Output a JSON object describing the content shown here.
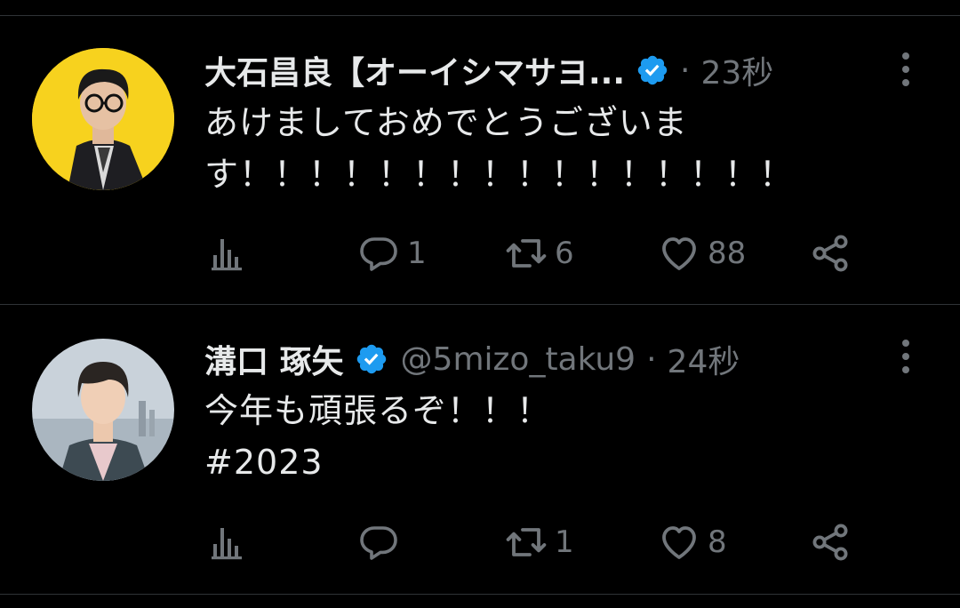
{
  "colors": {
    "background": "#000000",
    "text": "#e7e9ea",
    "muted": "#71767b",
    "divider": "#2f3336",
    "verified": "#1d9bf0"
  },
  "tweets": [
    {
      "name": "大石昌良【オーイシマサヨ...",
      "verified": true,
      "handle": "",
      "separator": "·",
      "time": "23秒",
      "lines": [
        "あけましておめでとうございま",
        "す！！！！！！！！！！！！！！！！"
      ],
      "actions": {
        "analytics_icon": "analytics-icon",
        "reply_count": "1",
        "retweet_count": "6",
        "like_count": "88",
        "share_icon": "share-icon"
      }
    },
    {
      "name": "溝口 琢矢",
      "verified": true,
      "handle": "@5mizo_taku9",
      "separator": "·",
      "time": "24秒",
      "lines": [
        "今年も頑張るぞ！！！",
        "#2023"
      ],
      "actions": {
        "analytics_icon": "analytics-icon",
        "reply_count": "",
        "retweet_count": "1",
        "like_count": "8",
        "share_icon": "share-icon"
      }
    }
  ]
}
